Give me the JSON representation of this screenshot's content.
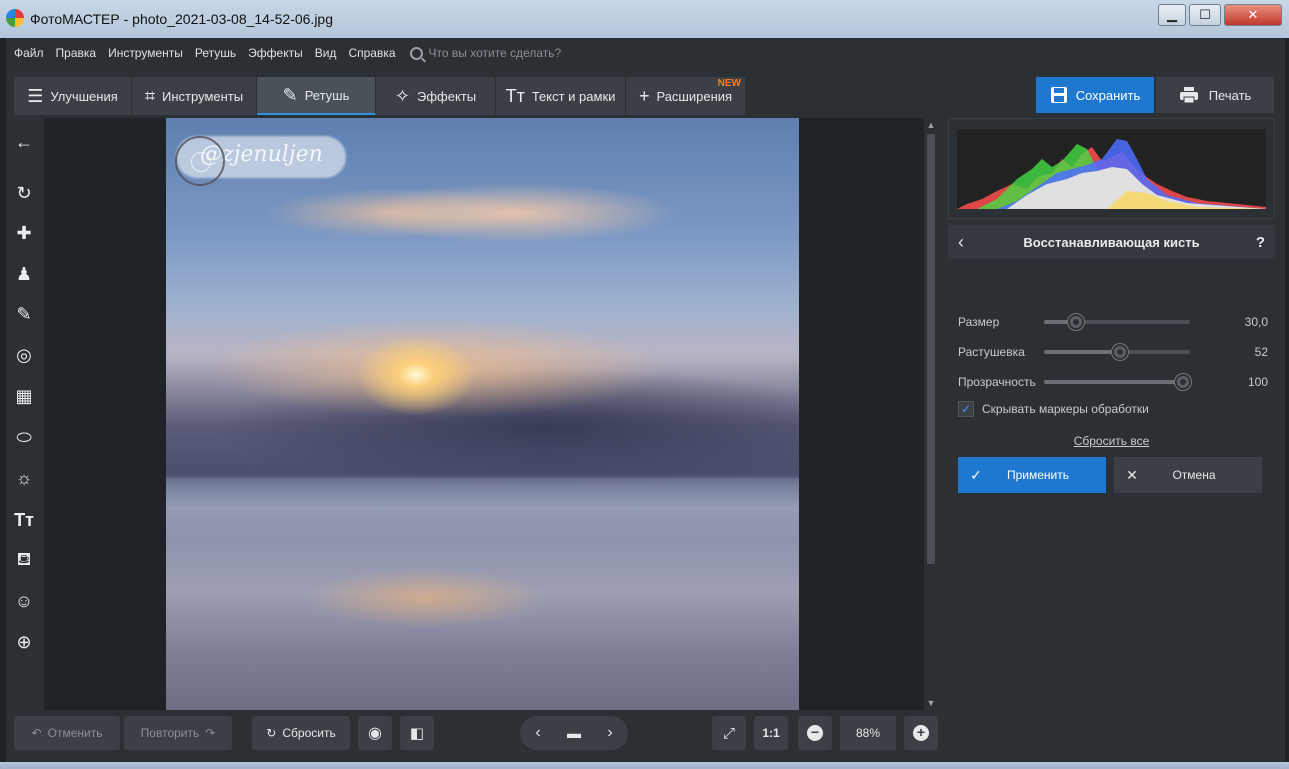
{
  "window": {
    "title": "ФотоМАСТЕР - photo_2021-03-08_14-52-06.jpg",
    "minimize": "▁",
    "maximize": "☐",
    "close": "✕"
  },
  "menu": {
    "items": [
      "Файл",
      "Правка",
      "Инструменты",
      "Ретушь",
      "Эффекты",
      "Вид",
      "Справка"
    ],
    "search_placeholder": "Что вы хотите сделать?"
  },
  "tabs": [
    {
      "label": "Улучшения",
      "icon": "sliders-icon",
      "glyph": "☰"
    },
    {
      "label": "Инструменты",
      "icon": "crop-icon",
      "glyph": "⌗"
    },
    {
      "label": "Ретушь",
      "icon": "brush-icon",
      "glyph": "✎",
      "active": true
    },
    {
      "label": "Эффекты",
      "icon": "magic-wand-icon",
      "glyph": "✧"
    },
    {
      "label": "Текст и рамки",
      "icon": "text-icon",
      "glyph": "Tт"
    },
    {
      "label": "Расширения",
      "icon": "plus-icon",
      "glyph": "+",
      "badge": "NEW"
    }
  ],
  "header_actions": {
    "save_label": "Сохранить",
    "print_label": "Печать"
  },
  "left_tools": [
    {
      "name": "back-arrow-icon",
      "glyph": "←"
    },
    {
      "name": "rotate-icon",
      "glyph": "↻"
    },
    {
      "name": "bandage-icon",
      "glyph": "✚"
    },
    {
      "name": "stamp-icon",
      "glyph": "♟"
    },
    {
      "name": "brush-tool-icon",
      "glyph": "✎"
    },
    {
      "name": "radial-filter-icon",
      "glyph": "◎"
    },
    {
      "name": "gradient-filter-icon",
      "glyph": "▦"
    },
    {
      "name": "vignette-icon",
      "glyph": "⬭"
    },
    {
      "name": "light-icon",
      "glyph": "☼"
    },
    {
      "name": "text-tool-icon",
      "glyph": "Tт"
    },
    {
      "name": "fill-bucket-icon",
      "glyph": "⛾"
    },
    {
      "name": "face-icon",
      "glyph": "☺"
    },
    {
      "name": "target-icon",
      "glyph": "⊕"
    }
  ],
  "photo": {
    "watermark": "@zjenuljen"
  },
  "panel": {
    "title": "Восстанавливающая кисть",
    "help": "?",
    "sliders": [
      {
        "label": "Размер",
        "value": "30,0",
        "level": 0.22
      },
      {
        "label": "Растушевка",
        "value": "52",
        "level": 0.52
      },
      {
        "label": "Прозрачность",
        "value": "100",
        "level": 0.95
      }
    ],
    "hide_markers_label": "Скрывать маркеры обработки",
    "hide_markers_checked": true,
    "reset_all": "Сбросить все",
    "apply_label": "Применить",
    "cancel_label": "Отмена"
  },
  "bottom": {
    "undo": "Отменить",
    "redo": "Повторить",
    "reset": "Сбросить",
    "zoom_fit": "1:1",
    "zoom_value": "88%"
  },
  "colors": {
    "accent": "#1e78cf",
    "new_badge": "#ff7a1a",
    "bg_dark": "#1f2327",
    "panel": "#2b3035"
  }
}
